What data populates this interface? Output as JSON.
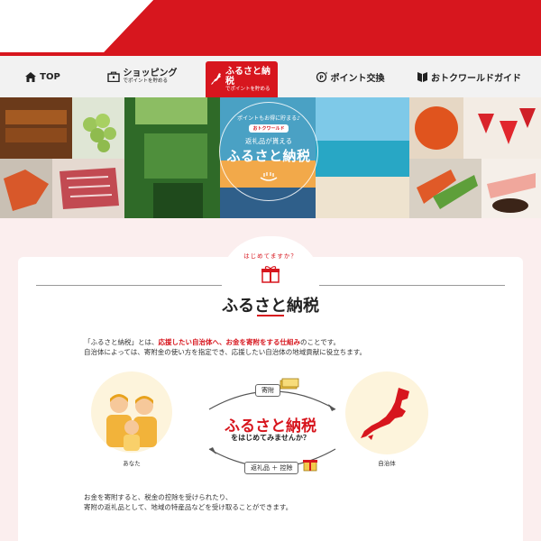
{
  "nav": {
    "items": [
      {
        "label": "TOP",
        "sub": ""
      },
      {
        "label": "ショッピング",
        "sub": "でポイントを貯める"
      },
      {
        "label": "ふるさと納税",
        "sub": "でポイントを貯める"
      },
      {
        "label": "ポイント交換",
        "sub": ""
      },
      {
        "label": "おトクワールドガイド",
        "sub": ""
      }
    ],
    "active_index": 2
  },
  "banner": {
    "arc_text": "ポイントもお得に貯まる♪",
    "logo_text": "おトクワールド",
    "line1": "返礼品が貰える",
    "line2": "ふるさと納税"
  },
  "intro": {
    "kicker": "はじめてますか？",
    "title": "ふるさと納税"
  },
  "paragraph1": {
    "a": "「ふるさと納税」とは、",
    "b": "応援したい自治体へ、お金を寄附をする仕組み",
    "c": "のことです。",
    "line2": "自治体によっては、寄附金の使い方を指定でき、応援したい自治体の地域貢献に役立ちます。"
  },
  "diagram": {
    "left_caption": "あなた",
    "right_caption": "自治体",
    "top_pill": "寄附",
    "bottom_pill": "返礼品 ＋ 控除",
    "center_title": "ふるさと納税",
    "center_sub": "をはじめてみませんか？"
  },
  "paragraph2": {
    "line1": "お金を寄附すると、税金の控除を受けられたり、",
    "line2": "寄附の返礼品として、地域の特産品などを受け取ることができます。"
  },
  "colors": {
    "brand_red": "#d7161e",
    "pink_bg": "#fbeeee",
    "cream": "#fdf4dc"
  }
}
